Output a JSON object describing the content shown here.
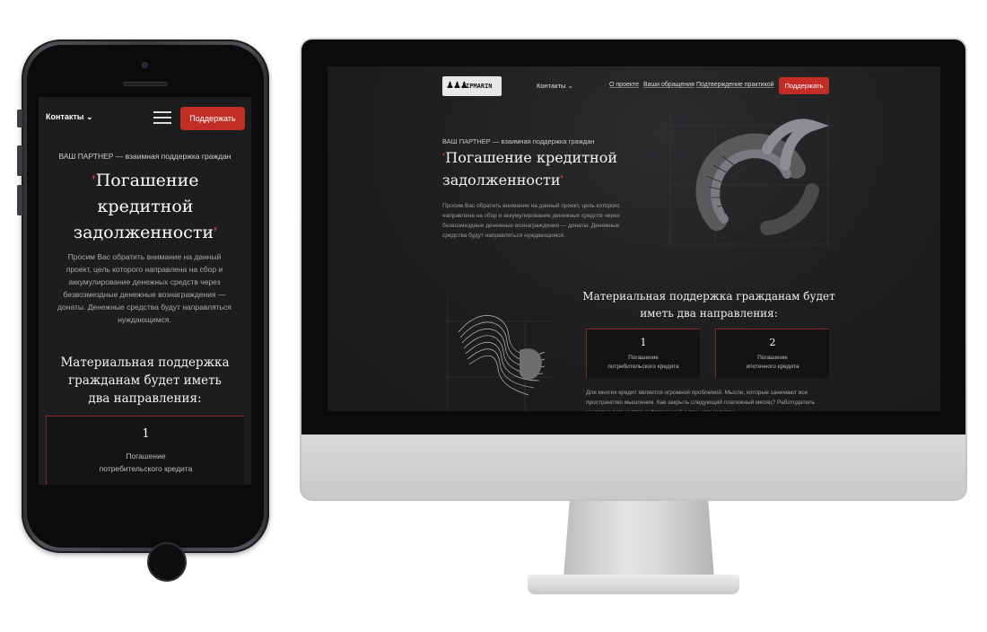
{
  "mobile": {
    "header": {
      "contacts_label": "Контакты ⌄",
      "support_button": "Поддержать"
    },
    "hero": {
      "partner": "ВАШ ПАРТНЕР — взаимная поддержка граждан",
      "title_line1": "Погашение",
      "title_line2": "кредитной",
      "title_line3": "задолженности",
      "description": "Просим Вас обратить внимание на данный проект, цель которого направлена на сбор и аккумулирование денежных средств через безвозмездные денежные вознаграждения — донаты. Денежные средства будут направляться нуждающимся."
    },
    "support_section": {
      "heading": "Материальная поддержка гражданам будет иметь два направления:",
      "card1_number": "1",
      "card1_line1": "Погашение",
      "card1_line2": "потребительского кредита"
    }
  },
  "desktop": {
    "header": {
      "logo_text": "IPMARIN",
      "contacts_label": "Контакты ⌄",
      "nav": [
        "О проекте",
        "Ваши обращения",
        "Подтверждение практикой"
      ],
      "support_button": "Поддержать"
    },
    "hero": {
      "partner": "ВАШ ПАРТНЕР — взаимная поддержка граждан",
      "title_line1": "Погашение кредитной",
      "title_line2": "задолженности",
      "description": "Просим Вас обратить внимание на данный проект, цель которого направлена на сбор и аккумулирование денежных средств через безвозмездные денежные вознаграждения — донаты. Денежные средства будут направляться нуждающимся."
    },
    "support_section": {
      "heading": "Материальная поддержка гражданам будет иметь два направления:",
      "cards": [
        {
          "number": "1",
          "line1": "Погашение",
          "line2": "потребительского кредита"
        },
        {
          "number": "2",
          "line1": "Погашение",
          "line2": "ипотечного кредита"
        }
      ],
      "paragraph": "Для многих кредит является огромной проблемой. Мысли, которые занимают все пространство мышления. Как закрыть следующий платежный месяц? Работодатель зачастую пользуется информацией о том, что человек"
    }
  },
  "colors": {
    "accent": "#c22d26",
    "background": "#1d1d1f",
    "text": "#f2f2f2"
  }
}
